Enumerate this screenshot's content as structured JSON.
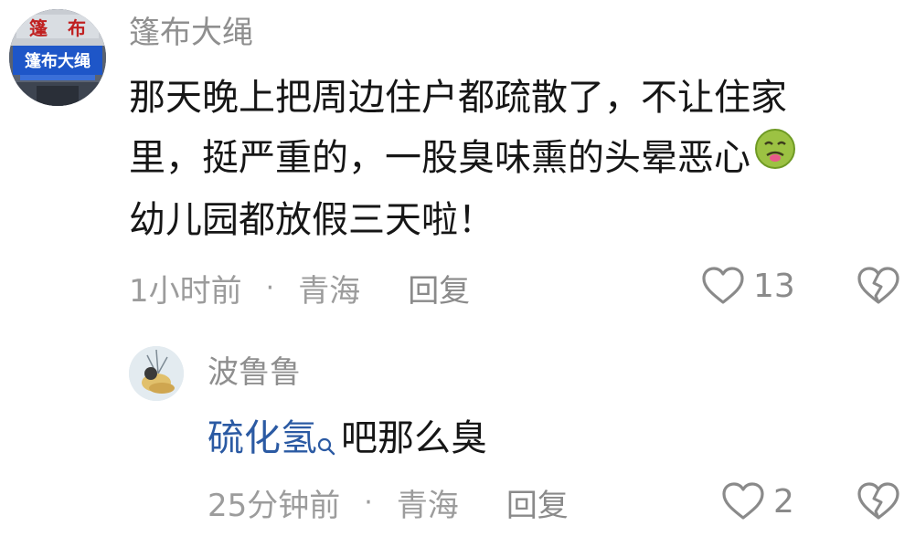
{
  "comments": [
    {
      "username": "篷布大绳",
      "avatar_sign": [
        "篷布大绳"
      ],
      "text_lines": [
        "那天晚上把周边住户都疏散了，不让住家",
        "里，挺严重的，一股臭味熏的头晕恶心",
        "幼儿园都放假三天啦！"
      ],
      "emoji": "nauseated-face-icon",
      "time": "1小时前",
      "separator": "·",
      "location": "青海",
      "reply_label": "回复",
      "like_count": "13"
    },
    {
      "username": "波鲁鲁",
      "text_link": "硫化氢",
      "text_rest": "吧那么臭",
      "time": "25分钟前",
      "separator": "·",
      "location": "青海",
      "reply_label": "回复",
      "like_count": "2"
    }
  ],
  "colors": {
    "link": "#2b5aa3",
    "meta": "#9c9c9c",
    "username": "#8f8f8f",
    "icon": "#8a8a8a"
  }
}
